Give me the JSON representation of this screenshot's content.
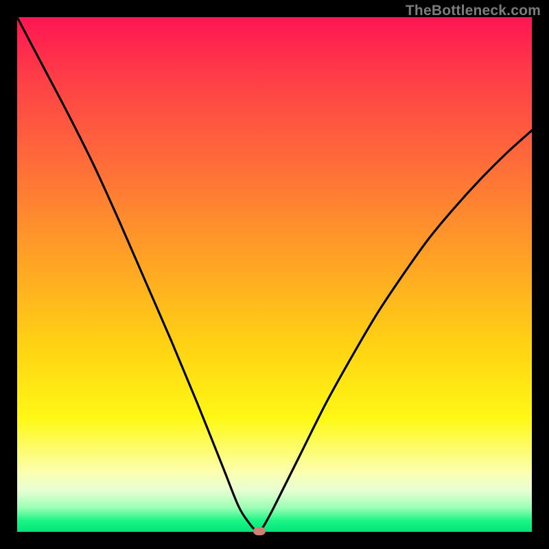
{
  "attribution": "TheBottleneck.com",
  "chart_data": {
    "type": "line",
    "title": "",
    "xlabel": "",
    "ylabel": "",
    "xlim": [
      0,
      100
    ],
    "ylim": [
      0,
      100
    ],
    "x": [
      0,
      5,
      10,
      15,
      20,
      25,
      30,
      35,
      40,
      43,
      45,
      46.5,
      47,
      48,
      50,
      55,
      60,
      65,
      70,
      75,
      80,
      85,
      90,
      95,
      100
    ],
    "y": [
      100,
      90.5,
      81,
      71,
      60,
      48.5,
      37,
      25,
      12.5,
      5,
      1.8,
      0.1,
      0.1,
      1.3,
      5,
      15,
      25,
      34,
      42.5,
      50,
      57,
      63,
      68.5,
      73.5,
      78
    ],
    "marker": {
      "x": 47,
      "y": 0.1
    },
    "gradient_stops": [
      {
        "pos": 0,
        "color": "#ff1552"
      },
      {
        "pos": 0.12,
        "color": "#ff3f47"
      },
      {
        "pos": 0.3,
        "color": "#ff7138"
      },
      {
        "pos": 0.48,
        "color": "#ffa524"
      },
      {
        "pos": 0.64,
        "color": "#ffd313"
      },
      {
        "pos": 0.78,
        "color": "#fff815"
      },
      {
        "pos": 0.885,
        "color": "#fbffb1"
      },
      {
        "pos": 0.92,
        "color": "#e6ffd3"
      },
      {
        "pos": 0.953,
        "color": "#9cffb5"
      },
      {
        "pos": 0.978,
        "color": "#1cf586"
      },
      {
        "pos": 1.0,
        "color": "#00e47a"
      }
    ]
  }
}
